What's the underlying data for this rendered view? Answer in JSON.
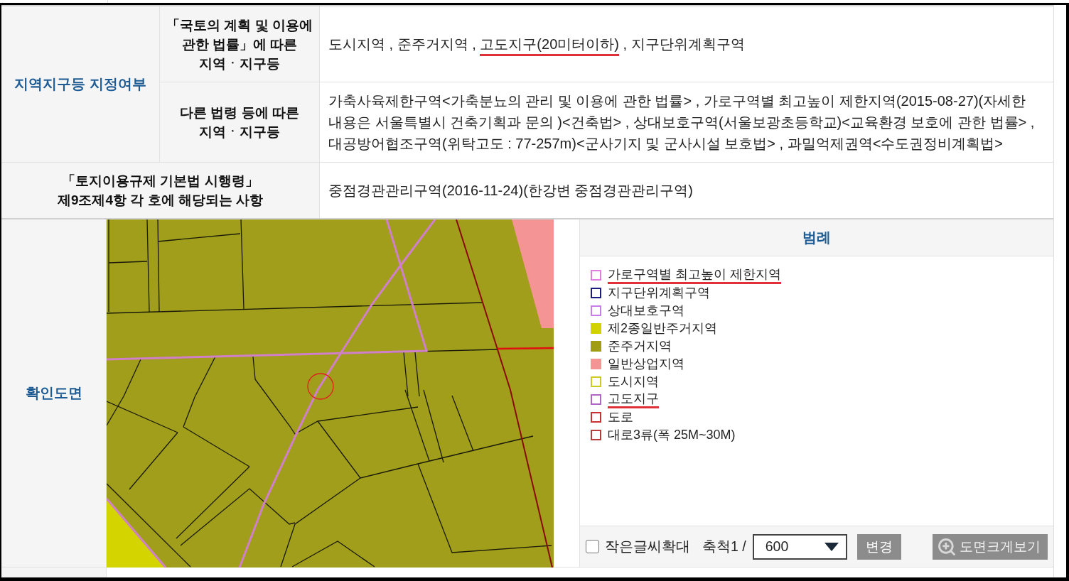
{
  "zoning": {
    "heading": "지역지구등 지정여부",
    "rows": [
      {
        "label_lines": [
          "「국토의 계획 및 이용에",
          "관한 법률」에 따른",
          "지역ㆍ지구등"
        ],
        "value": [
          {
            "text": "도시지역 , 준주거지역 , ",
            "underlined": false
          },
          {
            "text": "고도지구(20미터이하)",
            "underlined": true
          },
          {
            "text": " , 지구단위계획구역",
            "underlined": false
          }
        ]
      },
      {
        "label_lines": [
          "다른 법령 등에 따른",
          "지역ㆍ지구등"
        ],
        "value": [
          {
            "text": "가축사육제한구역<가축분뇨의 관리 및 이용에 관한 법률> , 가로구역별 최고높이 제한지역(2015-08-27)(자세한 내용은 서울특별시 건축기획과 문의 )<건축법> , 상대보호구역(서울보광초등학교)<교육환경 보호에 관한 법률> , 대공방어협조구역(위탁고도 : 77-257m)<군사기지 및 군사시설 보호법> , 과밀억제권역<수도권정비계획법>",
            "underlined": false
          }
        ]
      }
    ]
  },
  "enforcement": {
    "label_lines": [
      "「토지이용규제 기본법 시행령」",
      "제9조제4항 각 호에 해당되는 사항"
    ],
    "value": "중점경관관리구역(2016-11-24)(한강변 중점경관관리구역)"
  },
  "map_section": {
    "heading": "확인도면",
    "legend": {
      "title": "범례",
      "items": [
        {
          "label": "가로구역별 최고높이 제한지역",
          "kind": "outline",
          "color": "#e07ee0",
          "underlined": true
        },
        {
          "label": "지구단위계획구역",
          "kind": "outline",
          "color": "#1c1c80",
          "underlined": false
        },
        {
          "label": "상대보호구역",
          "kind": "outline",
          "color": "#c87ee8",
          "underlined": false
        },
        {
          "label": "제2종일반주거지역",
          "kind": "filled",
          "color": "#d2d200",
          "underlined": false
        },
        {
          "label": "준주거지역",
          "kind": "filled",
          "color": "#a09c14",
          "underlined": false
        },
        {
          "label": "일반상업지역",
          "kind": "filled",
          "color": "#f59494",
          "underlined": false
        },
        {
          "label": "도시지역",
          "kind": "outline",
          "color": "#cccc20",
          "underlined": false
        },
        {
          "label": "고도지구",
          "kind": "outline",
          "color": "#b066c4",
          "underlined": true
        },
        {
          "label": "도로",
          "kind": "outline",
          "color": "#c83232",
          "underlined": false
        },
        {
          "label": "대로3류(폭 25M~30M)",
          "kind": "outline",
          "color": "#b43c3c",
          "underlined": false
        }
      ]
    },
    "controls": {
      "enlarge": {
        "label": "작은글씨확대",
        "checked": false
      },
      "scale_label": "축척1 /",
      "scale_select": {
        "value": "600"
      },
      "buttons": [
        {
          "label": "변경",
          "kind": "plain"
        },
        {
          "label": "도면크게보기",
          "kind": "zoom"
        }
      ]
    }
  }
}
